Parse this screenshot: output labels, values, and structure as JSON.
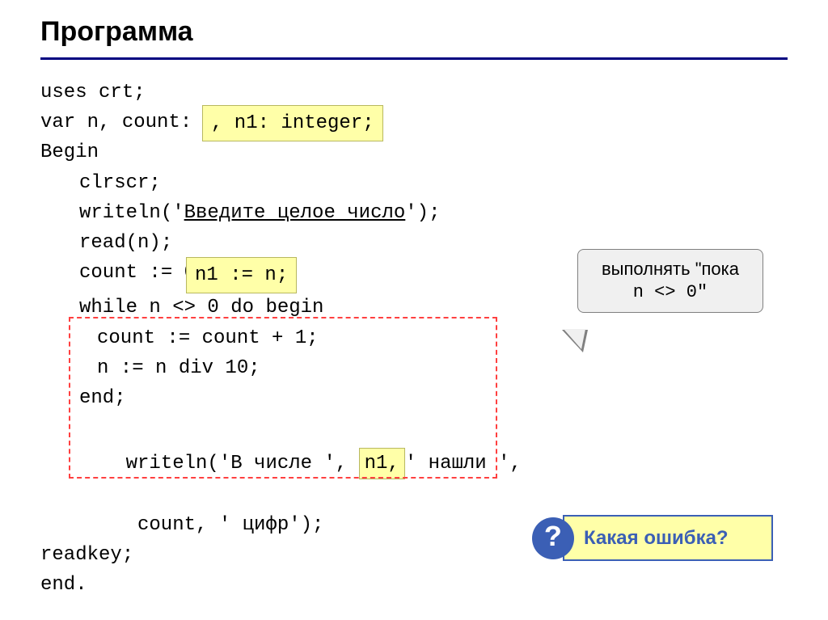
{
  "title": "Программа",
  "code": {
    "l1": "uses crt;",
    "l2": "var n, count: ",
    "l3": "Begin",
    "l4": "clrscr;",
    "l5a": "writeln('",
    "l5b": "Введите целое число",
    "l5c": "');",
    "l6": "read(n);",
    "l7": "count := 0;",
    "l8": "while n <> 0 do begin",
    "l9": "count := count + 1;",
    "l10": "n := n div 10;",
    "l11": "end;",
    "l12a": "writeln('В числе ', ",
    "l12b": "n1,",
    "l12c": "' нашли ',",
    "l13": "count, ' цифр');",
    "l14": "readkey;",
    "l15": "end."
  },
  "highlights": {
    "integer_decl": ", n1: integer;",
    "assign_n1": "n1 := n;"
  },
  "tooltip": {
    "line1": "выполнять \"пока",
    "line2": "n <> 0\""
  },
  "error": {
    "mark": "?",
    "text": "Какая ошибка?"
  }
}
